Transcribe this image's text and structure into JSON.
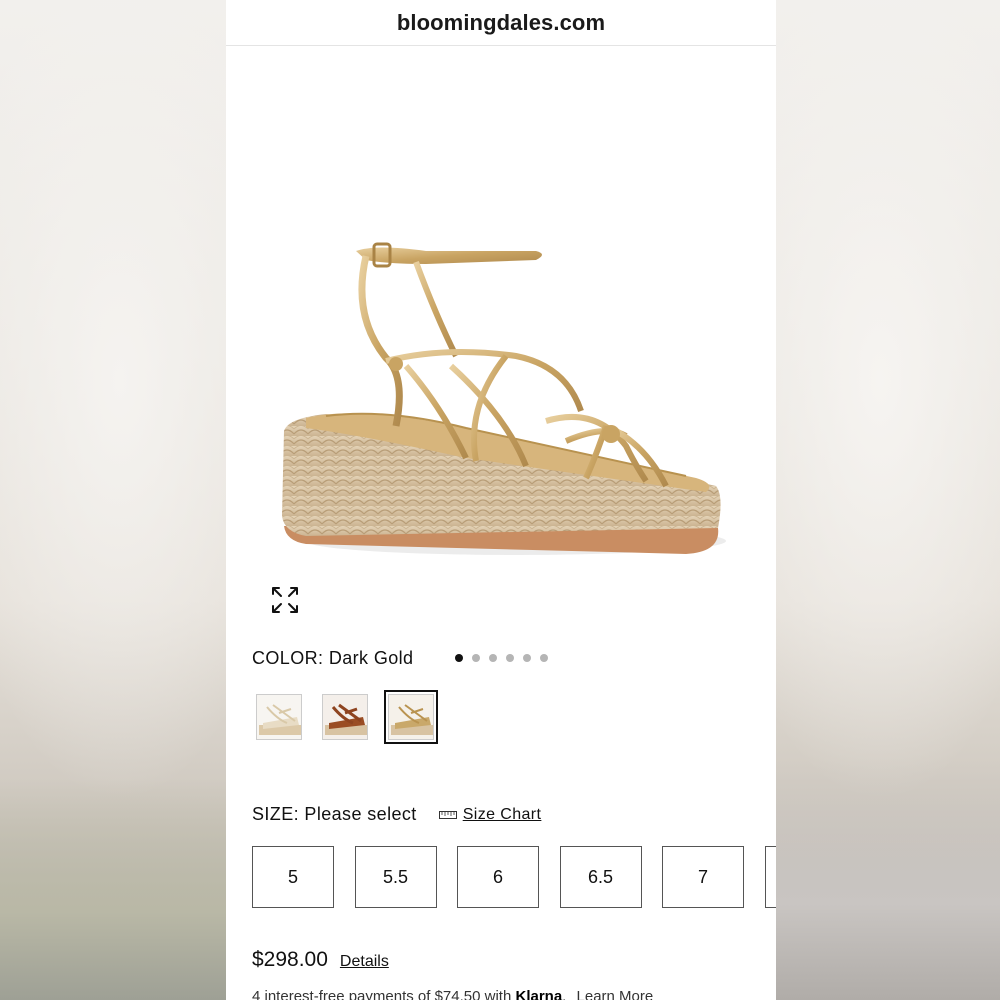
{
  "browser": {
    "url": "bloomingdales.com"
  },
  "gallery": {
    "expand_icon": "expand-arrows-icon",
    "dots_count": 6,
    "active_dot": 0
  },
  "color": {
    "label": "COLOR:",
    "value": "Dark Gold",
    "swatches": [
      {
        "name": "Platinum"
      },
      {
        "name": "Cognac"
      },
      {
        "name": "Dark Gold",
        "selected": true
      }
    ]
  },
  "size": {
    "label": "SIZE:",
    "value": "Please select",
    "chart_icon": "ruler-icon",
    "chart_label": "Size Chart",
    "options": [
      "5",
      "5.5",
      "6",
      "6.5",
      "7"
    ]
  },
  "price": {
    "amount": "$298.00",
    "details_label": "Details"
  },
  "klarna": {
    "prefix": "4 interest-free payments of $74.50 with",
    "brand": "Klarna",
    "suffix": ".",
    "learn_more": "Learn More"
  },
  "colors": {
    "accent": "#111111",
    "gold": "#c9a86a",
    "jute": "#d8c3a2"
  }
}
